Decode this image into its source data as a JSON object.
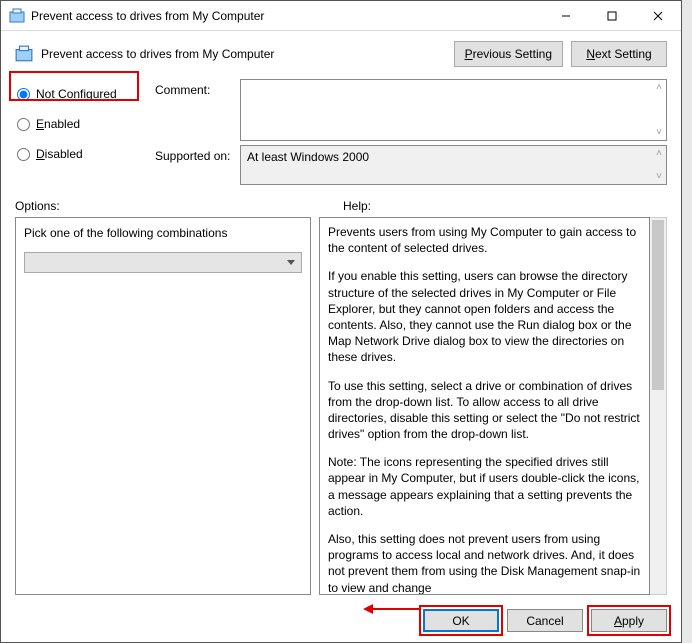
{
  "window": {
    "title": "Prevent access to drives from My Computer"
  },
  "header": {
    "policy_name": "Prevent access to drives from My Computer",
    "prev_html": "<u>P</u>revious Setting",
    "next_html": "<u>N</u>ext Setting"
  },
  "state": {
    "not_configured_html": "Not <u>C</u>onfigured",
    "enabled_html": "<u>E</u>nabled",
    "disabled_html": "<u>D</u>isabled",
    "selected": "not_configured"
  },
  "labels": {
    "comment": "Comment:",
    "supported": "Supported on:",
    "options": "Options:",
    "help": "Help:"
  },
  "supported_text": "At least Windows 2000",
  "options_panel": {
    "prompt": "Pick one of the following combinations",
    "combo_value": ""
  },
  "help_text": {
    "p1": "Prevents users from using My Computer to gain access to the content of selected drives.",
    "p2": "If you enable this setting, users can browse the directory structure of the selected drives in My Computer or File Explorer, but they cannot open folders and access the contents. Also, they cannot use the Run dialog box or the Map Network Drive dialog box to view the directories on these drives.",
    "p3": "To use this setting, select a drive or combination of drives from the drop-down list. To allow access to all drive directories, disable this setting or select the \"Do not restrict drives\" option from the drop-down list.",
    "p4": "Note: The icons representing the specified drives still appear in My Computer, but if users double-click the icons, a message appears explaining that a setting prevents the action.",
    "p5": " Also, this setting does not prevent users from using programs to access local and network drives. And, it does not prevent them from using the Disk Management snap-in to view and change"
  },
  "footer": {
    "ok": "OK",
    "cancel": "Cancel",
    "apply_html": "<u>A</u>pply"
  }
}
